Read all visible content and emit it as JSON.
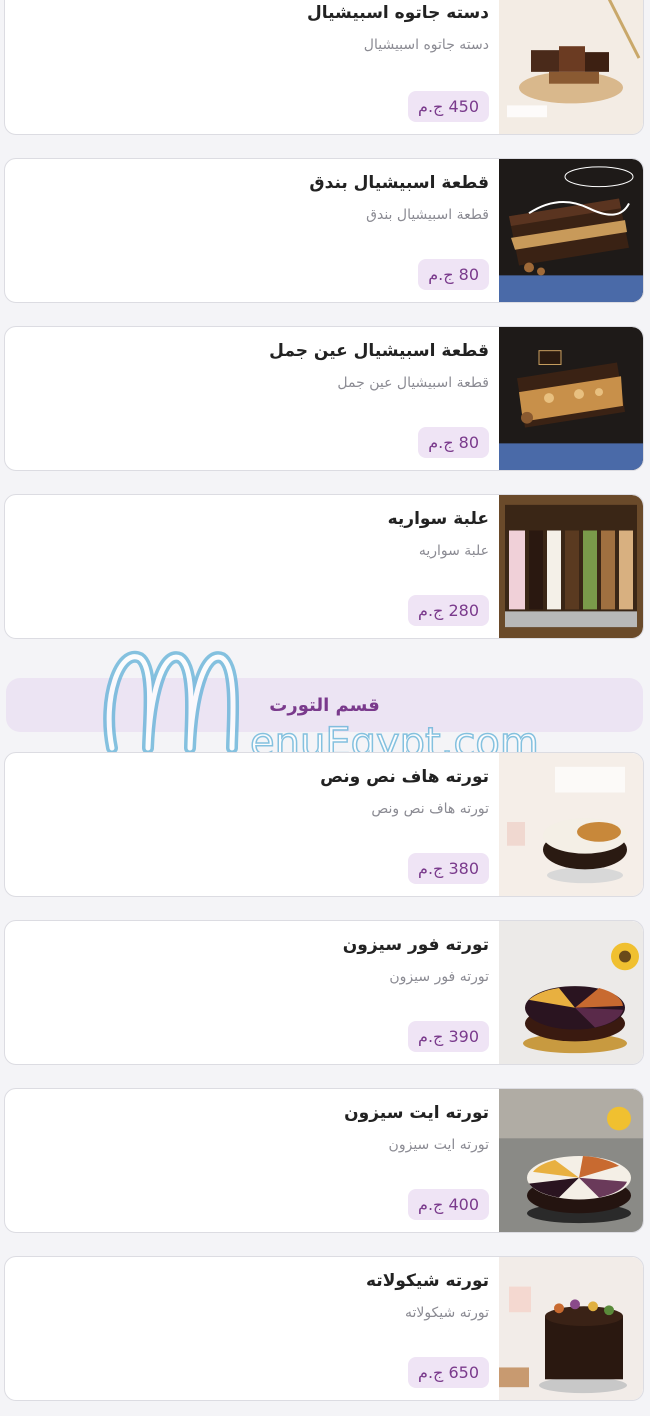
{
  "products_top": [
    {
      "title": "دسته جاتوه اسبيشيال",
      "desc": "دسته جاتوه اسبيشيال",
      "price": "450 ج.م"
    },
    {
      "title": "قطعة اسبيشيال بندق",
      "desc": "قطعة اسبيشيال بندق",
      "price": "80 ج.م"
    },
    {
      "title": "قطعة اسبيشيال عين جمل",
      "desc": "قطعة اسبيشيال عين جمل",
      "price": "80 ج.م"
    },
    {
      "title": "علبة سواريه",
      "desc": "علبة سواريه",
      "price": "280 ج.م"
    }
  ],
  "section": {
    "label": "قسم التورت"
  },
  "watermark": {
    "text": "MenuEgypt.com"
  },
  "products_cakes": [
    {
      "title": "تورته هاف نص ونص",
      "desc": "تورته هاف نص ونص",
      "price": "380 ج.م"
    },
    {
      "title": "تورته فور سيزون",
      "desc": "تورته فور سيزون",
      "price": "390 ج.م"
    },
    {
      "title": "تورته ايت سيزون",
      "desc": "تورته ايت سيزون",
      "price": "400 ج.م"
    },
    {
      "title": "تورته شيكولاته",
      "desc": "تورته شيكولاته",
      "price": "650 ج.م"
    }
  ],
  "colors": {
    "accent": "#7a3a8c",
    "price_bg": "#efe4f5",
    "section_bg": "#ece4f3"
  }
}
